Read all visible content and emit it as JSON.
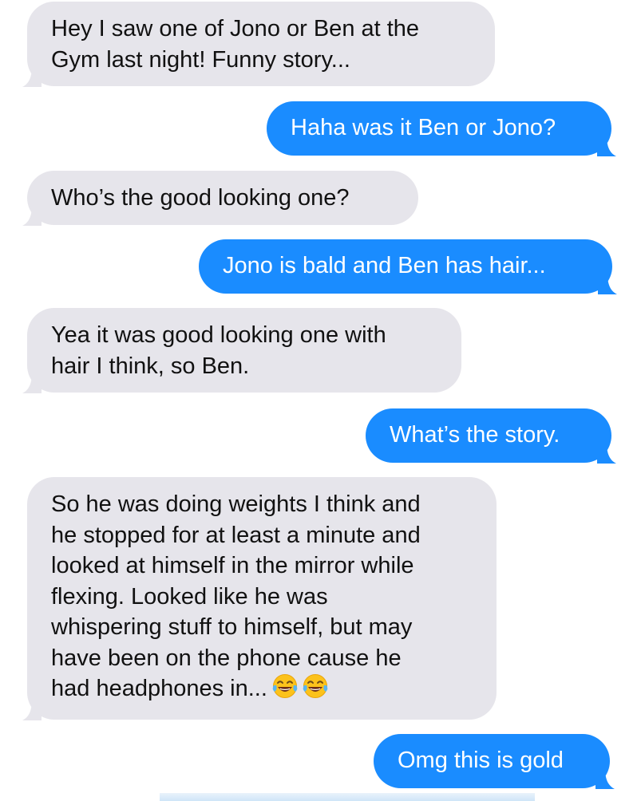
{
  "messages": [
    {
      "direction": "received",
      "lines": [
        "Hey I saw one of Jono or Ben at the",
        "Gym last night! Funny story..."
      ]
    },
    {
      "direction": "sent",
      "lines": [
        "Haha was it Ben or Jono?"
      ]
    },
    {
      "direction": "received",
      "lines": [
        "Who’s the good looking one?"
      ]
    },
    {
      "direction": "sent",
      "lines": [
        "Jono is bald and Ben has hair..."
      ]
    },
    {
      "direction": "received",
      "lines": [
        "Yea it was good looking one with",
        "hair I think, so Ben."
      ]
    },
    {
      "direction": "sent",
      "lines": [
        "What’s the story."
      ]
    },
    {
      "direction": "received",
      "lines": [
        "So he was doing weights I think and",
        "he stopped for at least a minute and",
        "looked at himself in the mirror while",
        "flexing. Looked like he was",
        "whispering stuff to himself, but may",
        "have been on the phone cause he",
        "had headphones in..."
      ]
    },
    {
      "direction": "sent",
      "lines": [
        "Omg this is gold"
      ]
    }
  ],
  "emoji": {
    "name": "face-with-tears-of-joy-icon",
    "count": 2
  },
  "colors": {
    "received_bubble": "#e6e5eb",
    "sent_bubble": "#1a8cff",
    "received_text": "#111111",
    "sent_text": "#ffffff"
  }
}
